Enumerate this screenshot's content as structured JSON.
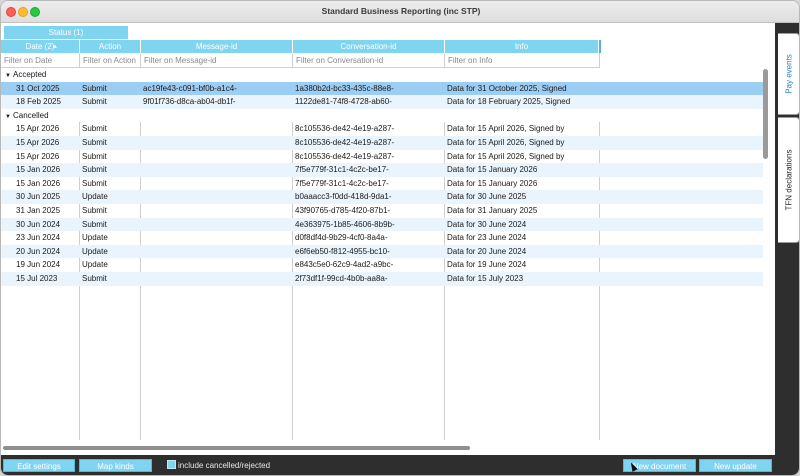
{
  "window": {
    "title": "Standard Business Reporting (inc STP)"
  },
  "status_tab": {
    "label": "Status (1)"
  },
  "table": {
    "columns": [
      {
        "label": "Date (2)",
        "filter": "Filter on Date"
      },
      {
        "label": "Action",
        "filter": "Filter on Action"
      },
      {
        "label": "Message-id",
        "filter": "Filter on Message-id"
      },
      {
        "label": "Conversation-id",
        "filter": "Filter on Conversation-id"
      },
      {
        "label": "Info",
        "filter": "Filter on Info"
      }
    ],
    "sort_indicator": "▲",
    "groups": [
      {
        "label": "Accepted",
        "rows": [
          {
            "date": "31 Oct 2025",
            "action": "Submit",
            "message_id": "ac19fe43-c091-bf0b-a1c4-",
            "conversation_id": "1a380b2d-bc33-435c-88e8-",
            "info": "Data for 31 October 2025, Signed",
            "selected": true
          },
          {
            "date": "18 Feb 2025",
            "action": "Submit",
            "message_id": "9f01f736-d8ca-ab04-db1f-",
            "conversation_id": "1122de81-74f8-4728-ab60-",
            "info": "Data for 18 February 2025, Signed"
          }
        ]
      },
      {
        "label": "Cancelled",
        "rows": [
          {
            "date": "15 Apr 2026",
            "action": "Submit",
            "message_id": "",
            "conversation_id": "8c105536-de42-4e19-a287-",
            "info": "Data for 15 April 2026, Signed by"
          },
          {
            "date": "15 Apr 2026",
            "action": "Submit",
            "message_id": "",
            "conversation_id": "8c105536-de42-4e19-a287-",
            "info": "Data for 15 April 2026, Signed by"
          },
          {
            "date": "15 Apr 2026",
            "action": "Submit",
            "message_id": "",
            "conversation_id": "8c105536-de42-4e19-a287-",
            "info": "Data for 15 April 2026, Signed by"
          },
          {
            "date": "15 Jan 2026",
            "action": "Submit",
            "message_id": "",
            "conversation_id": "7f5e779f-31c1-4c2c-be17-",
            "info": "Data for 15 January 2026"
          },
          {
            "date": "15 Jan 2026",
            "action": "Submit",
            "message_id": "",
            "conversation_id": "7f5e779f-31c1-4c2c-be17-",
            "info": "Data for 15 January 2026"
          },
          {
            "date": "30 Jun 2025",
            "action": "Update",
            "message_id": "",
            "conversation_id": "b0aaacc3-f0dd-418d-9da1-",
            "info": "Data for 30 June 2025"
          },
          {
            "date": "31 Jan 2025",
            "action": "Submit",
            "message_id": "",
            "conversation_id": "43f90765-d785-4f20-87b1-",
            "info": "Data for 31 January 2025"
          },
          {
            "date": "30 Jun 2024",
            "action": "Submit",
            "message_id": "",
            "conversation_id": "4e363975-1b85-4606-8b9b-",
            "info": "Data for 30 June 2024"
          },
          {
            "date": "23 Jun 2024",
            "action": "Update",
            "message_id": "",
            "conversation_id": "d0f8df4d-9b29-4cf0-8a4a-",
            "info": "Data for 23 June 2024"
          },
          {
            "date": "20 Jun 2024",
            "action": "Update",
            "message_id": "",
            "conversation_id": "e6f6eb50-f812-4955-bc10-",
            "info": "Data for 20 June 2024"
          },
          {
            "date": "19 Jun 2024",
            "action": "Update",
            "message_id": "",
            "conversation_id": "e843c5e0-62c9-4ad2-a9bc-",
            "info": "Data for 19 June 2024"
          },
          {
            "date": "15 Jul 2023",
            "action": "Submit",
            "message_id": "",
            "conversation_id": "2f73df1f-99cd-4b0b-aa8a-",
            "info": "Data for 15 July 2023"
          }
        ]
      }
    ]
  },
  "side_tabs": {
    "active": "Pay events",
    "inactive": "TFN declarations"
  },
  "bottom_bar": {
    "edit_settings": "Edit settings",
    "map_kinds": "Map kinds",
    "include_cancelled": "include cancelled/rejected",
    "new_document": "New document",
    "new_update": "New update"
  },
  "colors": {
    "accent": "#7fd4f0",
    "selected_row": "#9ccdf3",
    "alt_row": "#eaf4fc",
    "rail": "#2e2e2e"
  }
}
